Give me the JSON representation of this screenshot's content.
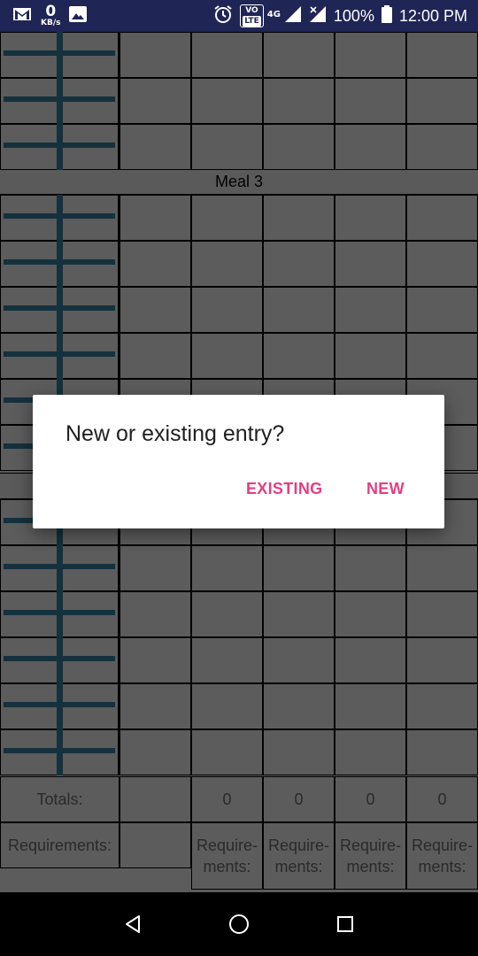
{
  "status_bar": {
    "data_speed_value": "0",
    "data_speed_unit": "KB/s",
    "network_type": "4G",
    "volte": "VO",
    "volte_lte": "LTE",
    "battery_percent": "100%",
    "time": "12:00 PM",
    "icons": [
      "gmail-icon",
      "gallery-icon",
      "alarm-icon",
      "volte-icon",
      "signal-icon",
      "signal-x-icon",
      "battery-icon"
    ]
  },
  "table": {
    "section_label": "Meal 3",
    "totals": {
      "label": "Totals:",
      "values": [
        "0",
        "0",
        "0",
        "0"
      ]
    },
    "requirements": {
      "label": "Requirements:",
      "values": [
        "Require-\nments:",
        "Require-\nments:",
        "Require-\nments:",
        "Require-\nments:"
      ]
    }
  },
  "dialog": {
    "title": "New or existing entry?",
    "existing_label": "EXISTING",
    "new_label": "NEW",
    "accent_color": "#e63d82"
  },
  "nav_bar": {
    "buttons": [
      "back-icon",
      "home-icon",
      "recents-icon"
    ]
  }
}
